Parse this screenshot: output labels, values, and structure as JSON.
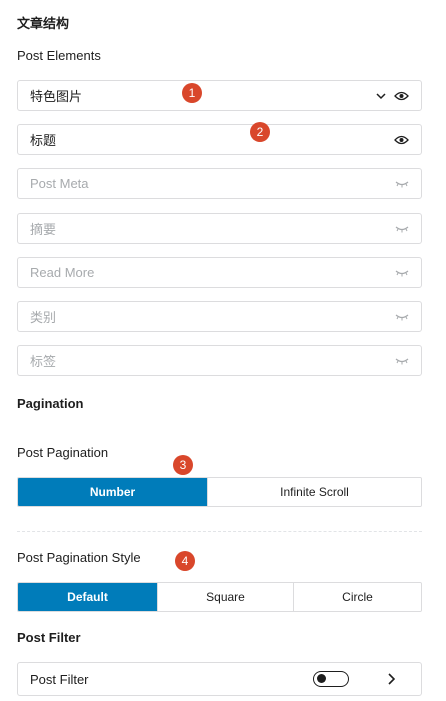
{
  "sections": {
    "structure_title": "文章结构",
    "post_elements_label": "Post Elements",
    "pagination_title": "Pagination",
    "post_pagination_label": "Post Pagination",
    "pagination_style_label": "Post Pagination Style",
    "post_filter_title": "Post Filter"
  },
  "elements": [
    {
      "label": "特色图片",
      "enabled": true,
      "has_dropdown": true
    },
    {
      "label": "标题",
      "enabled": true,
      "has_dropdown": false
    },
    {
      "label": "Post Meta",
      "enabled": false
    },
    {
      "label": "摘要",
      "enabled": false
    },
    {
      "label": "Read More",
      "enabled": false
    },
    {
      "label": "类别",
      "enabled": false
    },
    {
      "label": "标签",
      "enabled": false
    }
  ],
  "pagination": {
    "options": [
      "Number",
      "Infinite Scroll"
    ],
    "selected": "Number"
  },
  "pagination_style": {
    "options": [
      "Default",
      "Square",
      "Circle"
    ],
    "selected": "Default"
  },
  "post_filter": {
    "label": "Post Filter",
    "toggle_on": false
  },
  "badges": [
    "1",
    "2",
    "3",
    "4"
  ],
  "colors": {
    "accent": "#007cba",
    "badge": "#d9472b",
    "disabled_text": "#a7aaad",
    "border": "#dcdcde"
  }
}
